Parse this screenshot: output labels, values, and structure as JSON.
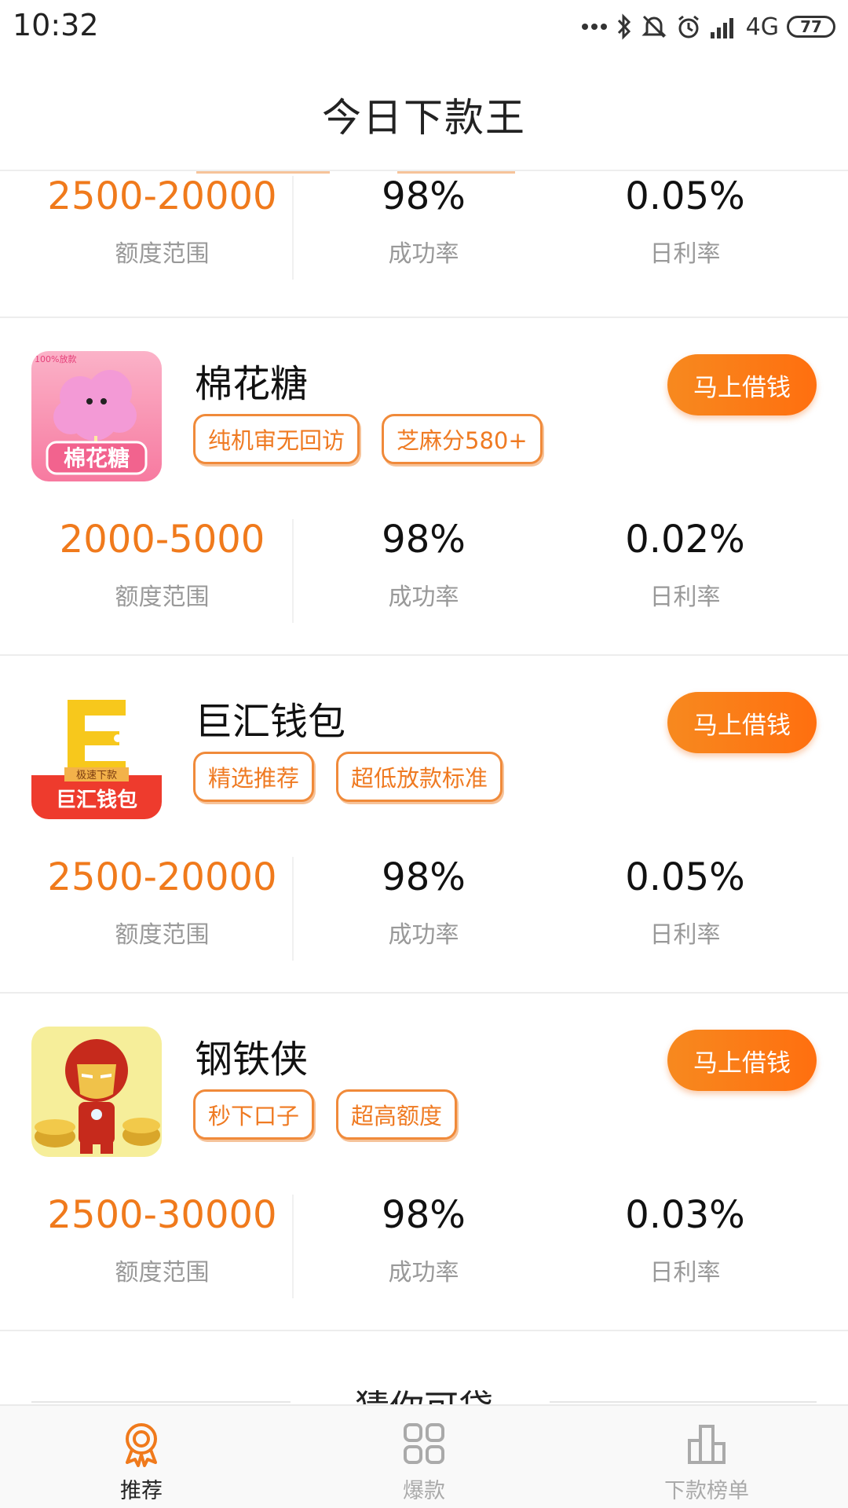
{
  "status_bar": {
    "time": "10:32",
    "network": "4G",
    "battery": "77"
  },
  "header": {
    "title": "今日下款王"
  },
  "colors": {
    "accent": "#f07a1c",
    "button": "#ff7a15",
    "label": "#999999"
  },
  "top_stats": {
    "amount": "2500-20000",
    "amount_label": "额度范围",
    "success": "98%",
    "success_label": "成功率",
    "rate": "0.05%",
    "rate_label": "日利率"
  },
  "products": [
    {
      "name": "棉花糖",
      "logo_icon": "cotton-candy-logo",
      "logo_text": "棉花糖",
      "logo_badge": "100%放款",
      "tags": [
        "纯机审无回访",
        "芝麻分580+"
      ],
      "button": "马上借钱",
      "amount": "2000-5000",
      "amount_label": "额度范围",
      "success": "98%",
      "success_label": "成功率",
      "rate": "0.02%",
      "rate_label": "日利率"
    },
    {
      "name": "巨汇钱包",
      "logo_icon": "wallet-logo",
      "logo_text": "巨汇钱包",
      "logo_badge": "极速下款",
      "tags": [
        "精选推荐",
        "超低放款标准"
      ],
      "button": "马上借钱",
      "amount": "2500-20000",
      "amount_label": "额度范围",
      "success": "98%",
      "success_label": "成功率",
      "rate": "0.05%",
      "rate_label": "日利率"
    },
    {
      "name": "钢铁侠",
      "logo_icon": "iron-man-logo",
      "tags": [
        "秒下口子",
        "超高额度"
      ],
      "button": "马上借钱",
      "amount": "2500-30000",
      "amount_label": "额度范围",
      "success": "98%",
      "success_label": "成功率",
      "rate": "0.03%",
      "rate_label": "日利率"
    }
  ],
  "section_title": "猜你可贷",
  "tabs": [
    {
      "label": "推荐",
      "icon": "award-icon",
      "active": true
    },
    {
      "label": "爆款",
      "icon": "grid-icon",
      "active": false
    },
    {
      "label": "下款榜单",
      "icon": "bar-chart-icon",
      "active": false
    }
  ]
}
